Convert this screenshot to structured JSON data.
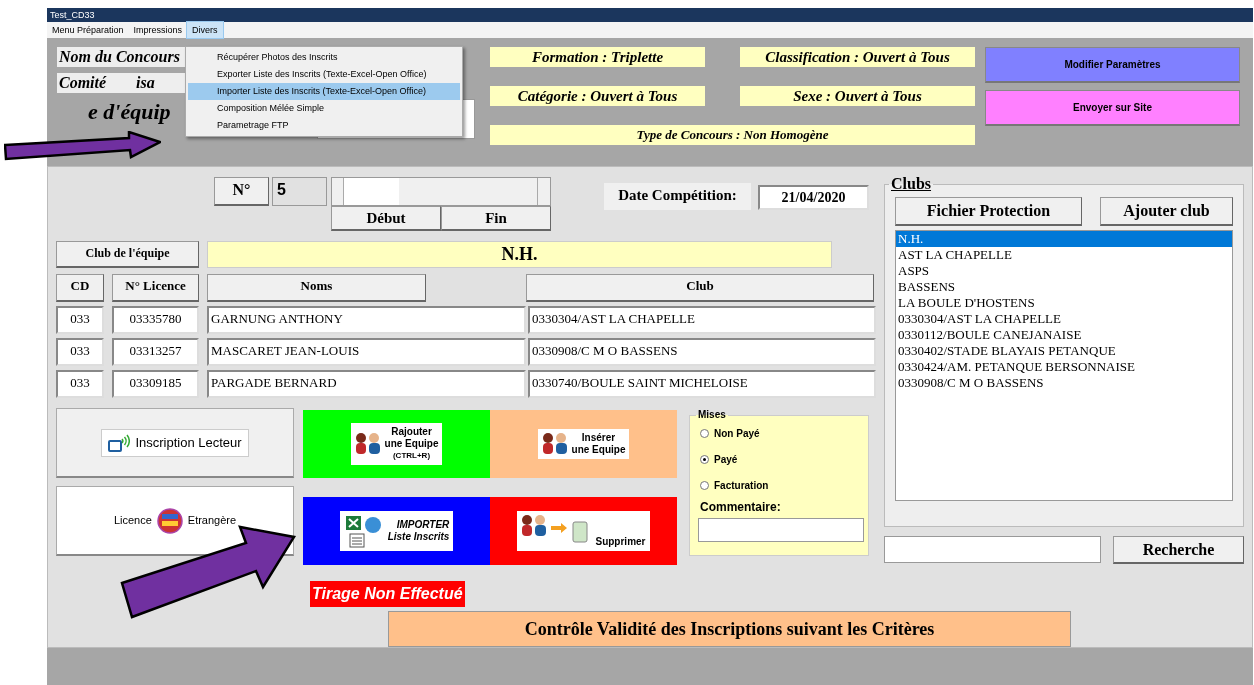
{
  "window": {
    "title": "Test_CD33"
  },
  "menu": [
    {
      "label": "Menu Préparation",
      "selected": false
    },
    {
      "label": "Impressions",
      "selected": false
    },
    {
      "label": "Divers",
      "selected": true
    }
  ],
  "dropdown": [
    {
      "label": "Récupérer  Photos des Inscrits",
      "selected": false
    },
    {
      "label": "Exporter Liste des Inscrits (Texte-Excel-Open Office)",
      "selected": false
    },
    {
      "label": "Importer Liste des Inscrits (Texte-Excel-Open Office)",
      "selected": true
    },
    {
      "label": "Composition  Mélée Simple",
      "selected": false
    },
    {
      "label": "Parametrage FTP",
      "selected": false
    }
  ],
  "header": {
    "labels": [
      {
        "text": "Nom du Concours"
      },
      {
        "text": "Comité",
        "tail": "isa"
      },
      {
        "text": "e d'équip"
      }
    ],
    "info": [
      "Formation : Triplette",
      "Classification : Ouvert à Tous",
      "Catégorie : Ouvert à Tous",
      "Sexe : Ouvert à Tous"
    ],
    "type_line": "Type de Concours : Non Homogène",
    "actions": [
      {
        "label": "Modifier Paramètres",
        "color": "#8080ff"
      },
      {
        "label": "Envoyer sur Site",
        "color": "#ff80ff"
      }
    ]
  },
  "team": {
    "number_label": "N°",
    "number": "5",
    "nav_buttons": [
      "Début",
      "Fin"
    ],
    "date_label": "Date Compétition:",
    "date": "21/04/2020",
    "club_label": "Club de l'équipe",
    "club": "N.H.",
    "columns": [
      "CD",
      "N° Licence",
      "Noms",
      "Club"
    ],
    "rows": [
      {
        "cd": "033",
        "licence": "03335780",
        "name": "GARNUNG ANTHONY",
        "club": "0330304/AST LA CHAPELLE"
      },
      {
        "cd": "033",
        "licence": "03313257",
        "name": "MASCARET JEAN-LOUIS",
        "club": "0330908/C M O BASSENS"
      },
      {
        "cd": "033",
        "licence": "03309185",
        "name": "PARGADE BERNARD",
        "club": "0330740/BOULE SAINT MICHELOISE"
      }
    ]
  },
  "side_buttons": [
    {
      "kind": "reader",
      "lines": [
        "Inscription Lecteur"
      ]
    },
    {
      "kind": "foreign",
      "lines": [
        "Licence",
        "Etrangère"
      ]
    }
  ],
  "tiles": [
    {
      "kind": "add",
      "color": "#00ff00",
      "lines": [
        "Rajouter",
        "une Equipe",
        "(CTRL+R)"
      ]
    },
    {
      "kind": "insert",
      "color": "#ffc08a",
      "lines": [
        "Insérer",
        "une Equipe"
      ]
    },
    {
      "kind": "import",
      "color": "#0000ff",
      "lines": [
        "IMPORTER",
        "Liste Inscrits"
      ]
    },
    {
      "kind": "delete",
      "color": "#ff0000",
      "lines": [
        "Supprimer"
      ]
    }
  ],
  "mises": {
    "title": "Mises",
    "options": [
      {
        "label": "Non Payé",
        "selected": false
      },
      {
        "label": "Payé",
        "selected": true
      },
      {
        "label": "Facturation",
        "selected": false
      }
    ],
    "comment_label": "Commentaire:"
  },
  "status_badge": "Tirage Non Effectué",
  "check_button": "Contrôle Validité des Inscriptions suivant les Critères",
  "clubs": {
    "title": "Clubs",
    "buttons": [
      "Fichier Protection",
      "Ajouter club"
    ],
    "items": [
      {
        "label": "N.H.",
        "selected": true
      },
      {
        "label": "AST LA CHAPELLE",
        "selected": false
      },
      {
        "label": "ASPS",
        "selected": false
      },
      {
        "label": "BASSENS",
        "selected": false
      },
      {
        "label": "LA BOULE D'HOSTENS",
        "selected": false
      },
      {
        "label": "0330304/AST LA CHAPELLE",
        "selected": false
      },
      {
        "label": "0330112/BOULE CANEJANAISE",
        "selected": false
      },
      {
        "label": "0330402/STADE BLAYAIS PETANQUE",
        "selected": false
      },
      {
        "label": "0330424/AM. PETANQUE BERSONNAISE",
        "selected": false
      },
      {
        "label": "0330908/C M O BASSENS",
        "selected": false
      }
    ],
    "search_button": "Recherche"
  }
}
